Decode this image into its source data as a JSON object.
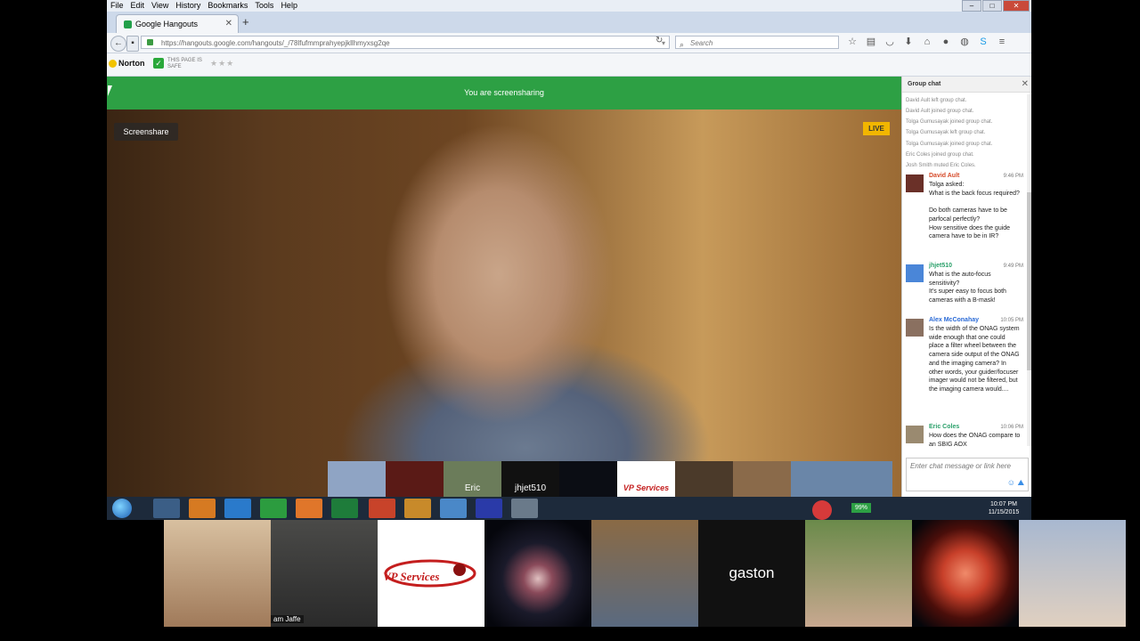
{
  "browser": {
    "menu": [
      "File",
      "Edit",
      "View",
      "History",
      "Bookmarks",
      "Tools",
      "Help"
    ],
    "tab_title": "Google Hangouts",
    "new_tab": "+",
    "url": "https://hangouts.google.com/hangouts/_/78lfufmmprahyepjkllhmyxsg2qe",
    "search_placeholder": "Search",
    "norton_label": "Norton",
    "safe_label": "THIS PAGE IS SAFE",
    "window_buttons": [
      "–",
      "□",
      "✕"
    ]
  },
  "hangout": {
    "banner": "You are screensharing",
    "screenshare_button": "Screenshare",
    "live_badge": "LIVE",
    "filmstrip": [
      {
        "label": "",
        "bg": "#8fa4c4"
      },
      {
        "label": "",
        "bg": "#5a1a16"
      },
      {
        "label": "Eric",
        "bg": "#6b7c5a"
      },
      {
        "label": "jhjet510",
        "bg": "#111111"
      },
      {
        "label": "",
        "bg": "#0b0d14"
      },
      {
        "label": "VP Services",
        "bg": "#ffffff"
      },
      {
        "label": "",
        "bg": "#4b3a2a"
      },
      {
        "label": "",
        "bg": "#8a6a4a"
      },
      {
        "label": "",
        "bg": "#6a86a8"
      }
    ]
  },
  "chat": {
    "title": "Group chat",
    "system_messages": [
      "David Ault left group chat.",
      "David Ault joined group chat.",
      "Tolga Gumusayak joined group chat.",
      "Tolga Gumusayak left group chat.",
      "Tolga Gumusayak joined group chat.",
      "Eric Coles joined group chat.",
      "Josh Smith muted Eric Coles."
    ],
    "messages": [
      {
        "name": "David Ault",
        "time": "9:46 PM",
        "color": "#d64b2a",
        "body": "Tolga asked:\nWhat is the back focus required?\n\nDo both cameras have to be parfocal perfectly?\nHow sensitive does the guide camera have to be in IR?"
      },
      {
        "name": "jhjet510",
        "time": "9:49 PM",
        "color": "#2aa06a",
        "body": "What is the auto-focus sensitivity?\nIt's super easy to focus both cameras with a B-mask!"
      },
      {
        "name": "Alex McConahay",
        "time": "10:05 PM",
        "color": "#2a6ad6",
        "body": "Is the width of the ONAG system wide enough that one could place a filter wheel between the camera side output of the ONAG and the imaging camera? In other words, your guider/focuser imager would not be filtered, but the imaging camera would...."
      },
      {
        "name": "Eric Coles",
        "time": "10:06 PM",
        "color": "#2aa06a",
        "body": "How does the ONAG compare to an SBIG AOX"
      }
    ],
    "input_placeholder": "Enter chat message or link here"
  },
  "taskbar": {
    "battery": "99%",
    "time": "10:07 PM",
    "date": "11/15/2015"
  },
  "participants": [
    {
      "label": "",
      "bg": "#b08a6a"
    },
    {
      "label": "am Jaffe",
      "bg": "#3a3a3a"
    },
    {
      "label": "VP Services",
      "bg": "#ffffff"
    },
    {
      "label": "",
      "bg": "#0c0f1a"
    },
    {
      "label": "",
      "bg": "#6b5a45"
    },
    {
      "label": "gaston",
      "bg": "#111111"
    },
    {
      "label": "",
      "bg": "#8ca06a"
    },
    {
      "label": "",
      "bg": "#3a0e0c"
    },
    {
      "label": "",
      "bg": "#8ea0bc"
    }
  ]
}
